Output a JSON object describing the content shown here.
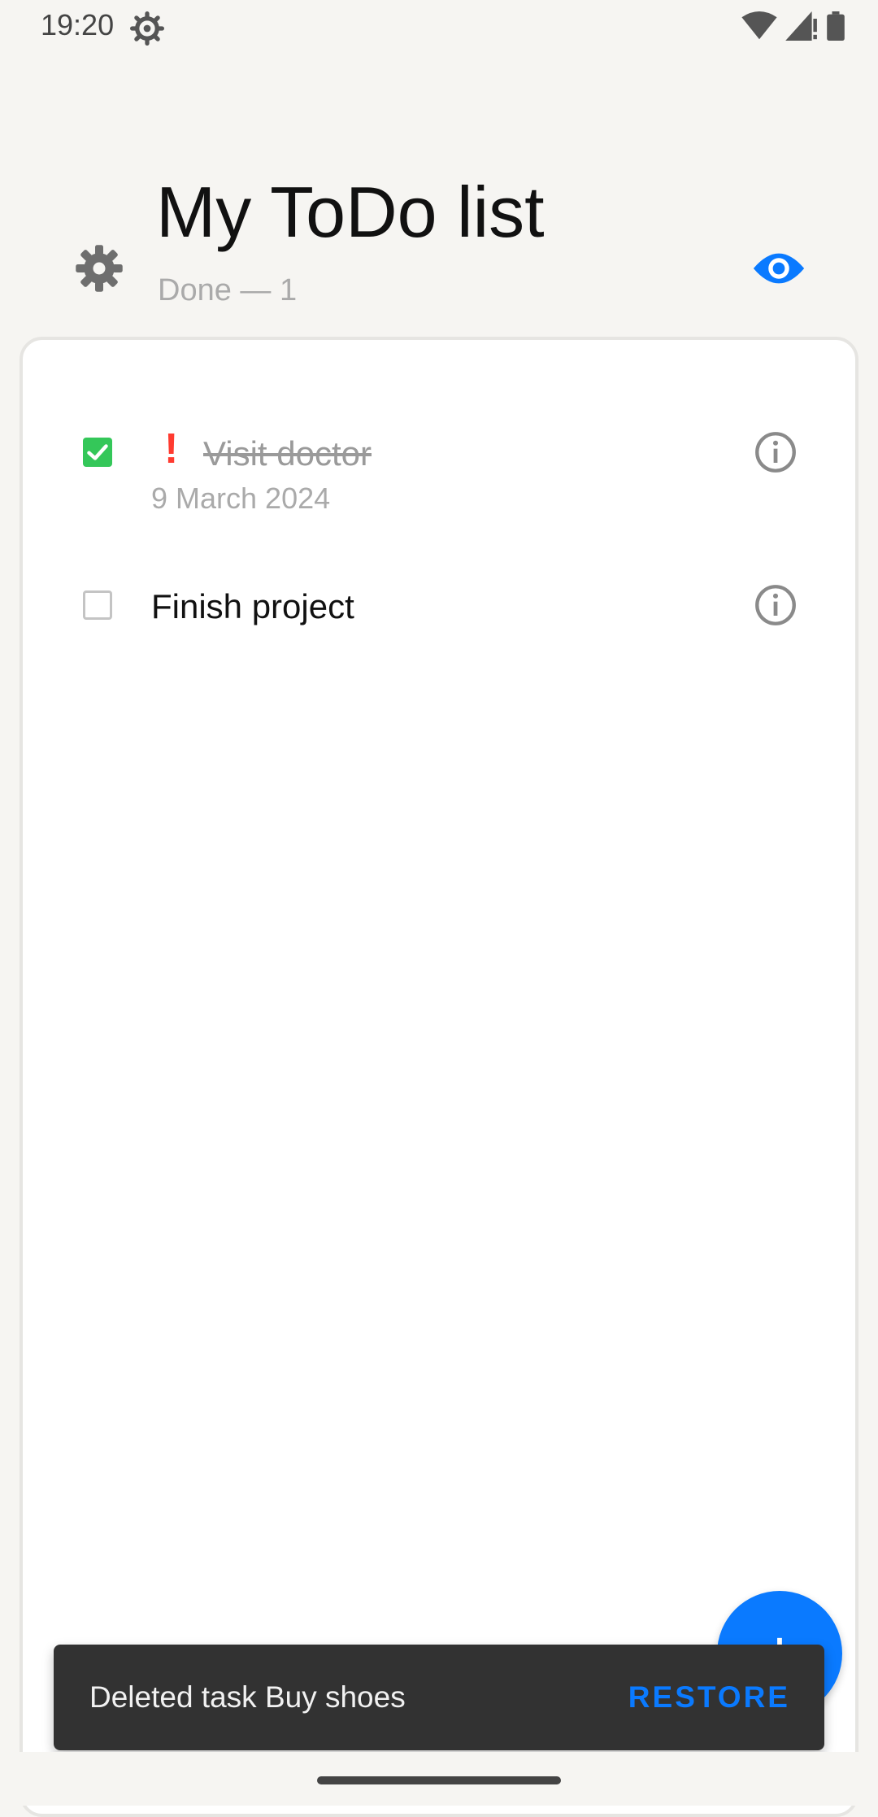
{
  "status_bar": {
    "time": "19:20",
    "icons": [
      "gear-icon",
      "wifi-icon",
      "signal-icon",
      "battery-icon"
    ]
  },
  "header": {
    "title": "My ToDo list",
    "subtitle": "Done — 1",
    "settings_icon": "gear-icon",
    "visibility_icon": "eye-icon",
    "accent_color": "#0a7aff"
  },
  "tasks": [
    {
      "title": "Visit doctor",
      "date": "9 March 2024",
      "done": true,
      "priority": "!",
      "priority_color": "#ff3b30",
      "info_icon": "info-icon"
    },
    {
      "title": "Finish project",
      "date": "",
      "done": false,
      "priority": "",
      "info_icon": "info-icon"
    }
  ],
  "fab": {
    "icon": "+",
    "color": "#0a7aff"
  },
  "snackbar": {
    "message": "Deleted task Buy shoes",
    "action": "RESTORE"
  },
  "colors": {
    "checked": "#34c759",
    "background": "#f6f5f2",
    "card": "#ffffff",
    "snackbar": "#323232"
  }
}
